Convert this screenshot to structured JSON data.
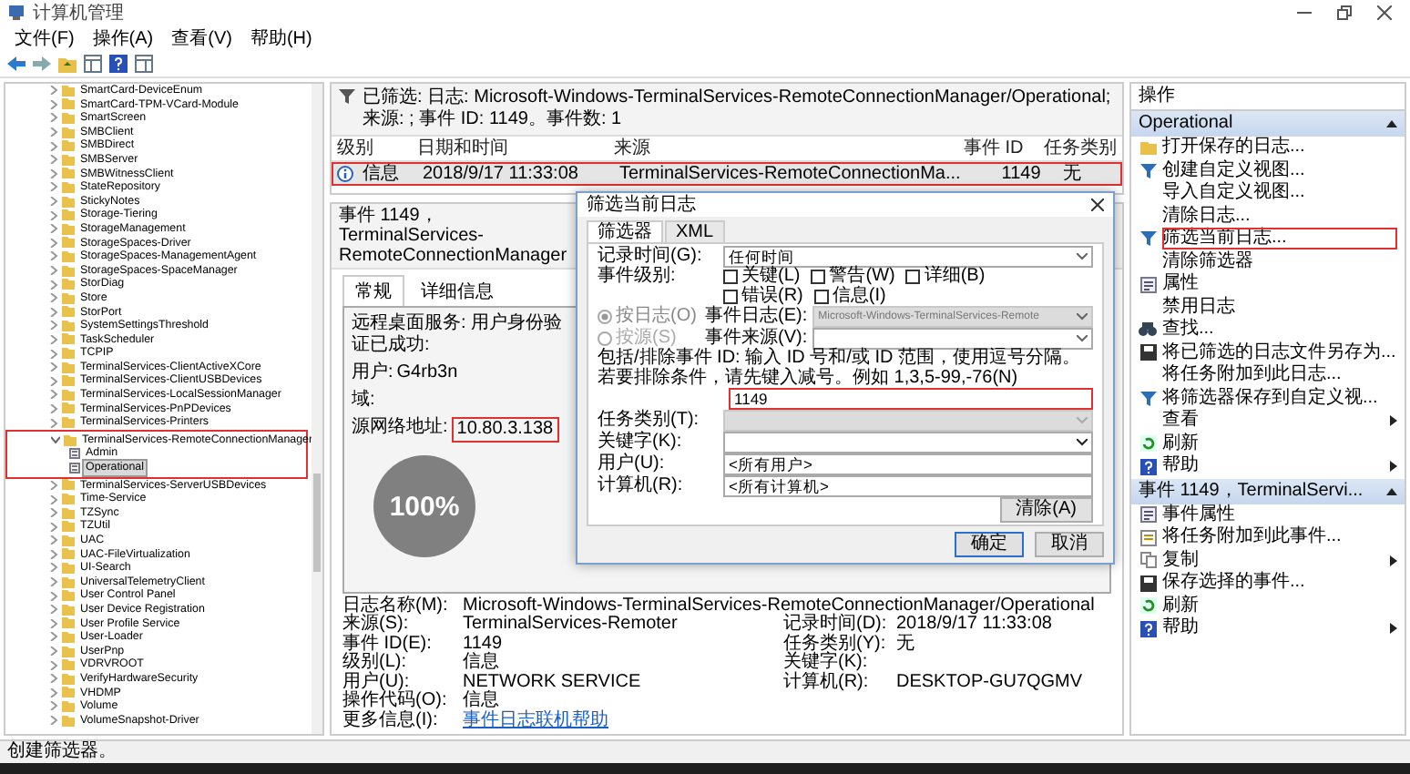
{
  "window": {
    "title": "计算机管理"
  },
  "menu": [
    "文件(F)",
    "操作(A)",
    "查看(V)",
    "帮助(H)"
  ],
  "tree": {
    "items": [
      {
        "label": "SmartCard-DeviceEnum",
        "kind": "folder",
        "expanded": false,
        "selected": false,
        "annotated": false
      },
      {
        "label": "SmartCard-TPM-VCard-Module",
        "kind": "folder",
        "expanded": false,
        "selected": false,
        "annotated": false
      },
      {
        "label": "SmartScreen",
        "kind": "folder",
        "expanded": false,
        "selected": false,
        "annotated": false
      },
      {
        "label": "SMBClient",
        "kind": "folder",
        "expanded": false,
        "selected": false,
        "annotated": false
      },
      {
        "label": "SMBDirect",
        "kind": "folder",
        "expanded": false,
        "selected": false,
        "annotated": false
      },
      {
        "label": "SMBServer",
        "kind": "folder",
        "expanded": false,
        "selected": false,
        "annotated": false
      },
      {
        "label": "SMBWitnessClient",
        "kind": "folder",
        "expanded": false,
        "selected": false,
        "annotated": false
      },
      {
        "label": "StateRepository",
        "kind": "folder",
        "expanded": false,
        "selected": false,
        "annotated": false
      },
      {
        "label": "StickyNotes",
        "kind": "folder",
        "expanded": false,
        "selected": false,
        "annotated": false
      },
      {
        "label": "Storage-Tiering",
        "kind": "folder",
        "expanded": false,
        "selected": false,
        "annotated": false
      },
      {
        "label": "StorageManagement",
        "kind": "folder",
        "expanded": false,
        "selected": false,
        "annotated": false
      },
      {
        "label": "StorageSpaces-Driver",
        "kind": "folder",
        "expanded": false,
        "selected": false,
        "annotated": false
      },
      {
        "label": "StorageSpaces-ManagementAgent",
        "kind": "folder",
        "expanded": false,
        "selected": false,
        "annotated": false
      },
      {
        "label": "StorageSpaces-SpaceManager",
        "kind": "folder",
        "expanded": false,
        "selected": false,
        "annotated": false
      },
      {
        "label": "StorDiag",
        "kind": "folder",
        "expanded": false,
        "selected": false,
        "annotated": false
      },
      {
        "label": "Store",
        "kind": "folder",
        "expanded": false,
        "selected": false,
        "annotated": false
      },
      {
        "label": "StorPort",
        "kind": "folder",
        "expanded": false,
        "selected": false,
        "annotated": false
      },
      {
        "label": "SystemSettingsThreshold",
        "kind": "folder",
        "expanded": false,
        "selected": false,
        "annotated": false
      },
      {
        "label": "TaskScheduler",
        "kind": "folder",
        "expanded": false,
        "selected": false,
        "annotated": false
      },
      {
        "label": "TCPIP",
        "kind": "folder",
        "expanded": false,
        "selected": false,
        "annotated": false
      },
      {
        "label": "TerminalServices-ClientActiveXCore",
        "kind": "folder",
        "expanded": false,
        "selected": false,
        "annotated": false
      },
      {
        "label": "TerminalServices-ClientUSBDevices",
        "kind": "folder",
        "expanded": false,
        "selected": false,
        "annotated": false
      },
      {
        "label": "TerminalServices-LocalSessionManager",
        "kind": "folder",
        "expanded": false,
        "selected": false,
        "annotated": false
      },
      {
        "label": "TerminalServices-PnPDevices",
        "kind": "folder",
        "expanded": false,
        "selected": false,
        "annotated": false
      },
      {
        "label": "TerminalServices-Printers",
        "kind": "folder",
        "expanded": false,
        "selected": false,
        "annotated": false
      },
      {
        "label": "TerminalServices-RemoteConnectionManager",
        "kind": "folder",
        "expanded": true,
        "selected": false,
        "annotated": true,
        "children": [
          {
            "label": "Admin",
            "kind": "log",
            "selected": false,
            "annotated": false
          },
          {
            "label": "Operational",
            "kind": "log",
            "selected": true,
            "annotated": false
          }
        ]
      },
      {
        "label": "TerminalServices-ServerUSBDevices",
        "kind": "folder",
        "expanded": false,
        "selected": false,
        "annotated": false
      },
      {
        "label": "Time-Service",
        "kind": "folder",
        "expanded": false,
        "selected": false,
        "annotated": false
      },
      {
        "label": "TZSync",
        "kind": "folder",
        "expanded": false,
        "selected": false,
        "annotated": false
      },
      {
        "label": "TZUtil",
        "kind": "folder",
        "expanded": false,
        "selected": false,
        "annotated": false
      },
      {
        "label": "UAC",
        "kind": "folder",
        "expanded": false,
        "selected": false,
        "annotated": false
      },
      {
        "label": "UAC-FileVirtualization",
        "kind": "folder",
        "expanded": false,
        "selected": false,
        "annotated": false
      },
      {
        "label": "UI-Search",
        "kind": "folder",
        "expanded": false,
        "selected": false,
        "annotated": false
      },
      {
        "label": "UniversalTelemetryClient",
        "kind": "folder",
        "expanded": false,
        "selected": false,
        "annotated": false
      },
      {
        "label": "User Control Panel",
        "kind": "folder",
        "expanded": false,
        "selected": false,
        "annotated": false
      },
      {
        "label": "User Device Registration",
        "kind": "folder",
        "expanded": false,
        "selected": false,
        "annotated": false
      },
      {
        "label": "User Profile Service",
        "kind": "folder",
        "expanded": false,
        "selected": false,
        "annotated": false
      },
      {
        "label": "User-Loader",
        "kind": "folder",
        "expanded": false,
        "selected": false,
        "annotated": false
      },
      {
        "label": "UserPnp",
        "kind": "folder",
        "expanded": false,
        "selected": false,
        "annotated": false
      },
      {
        "label": "VDRVROOT",
        "kind": "folder",
        "expanded": false,
        "selected": false,
        "annotated": false
      },
      {
        "label": "VerifyHardwareSecurity",
        "kind": "folder",
        "expanded": false,
        "selected": false,
        "annotated": false
      },
      {
        "label": "VHDMP",
        "kind": "folder",
        "expanded": false,
        "selected": false,
        "annotated": false
      },
      {
        "label": "Volume",
        "kind": "folder",
        "expanded": false,
        "selected": false,
        "annotated": false
      },
      {
        "label": "VolumeSnapshot-Driver",
        "kind": "folder",
        "expanded": false,
        "selected": false,
        "annotated": false
      }
    ]
  },
  "event_list": {
    "filter_text": "已筛选: 日志: Microsoft-Windows-TerminalServices-RemoteConnectionManager/Operational; 来源: ; 事件 ID: 1149。事件数: 1",
    "columns": [
      "级别",
      "日期和时间",
      "来源",
      "事件 ID",
      "任务类别"
    ],
    "rows": [
      {
        "cells": [
          "信息",
          "2018/9/17 11:33:08",
          "TerminalServices-RemoteConnectionMa...",
          "1149",
          "无"
        ],
        "selected": true,
        "annotated": true
      }
    ]
  },
  "event_detail": {
    "title": "事件 1149，TerminalServices-RemoteConnectionManager",
    "tabs": [
      {
        "label": "常规",
        "selected": true
      },
      {
        "label": "详细信息",
        "selected": false
      }
    ],
    "message": [
      {
        "label": "远程桌面服务: 用户身份验证已成功:",
        "annotated": false
      },
      {
        "label": "用户:",
        "value": "G4rb3n",
        "annotated": false
      },
      {
        "label": "域:",
        "annotated": false
      },
      {
        "label": "源网络地址:",
        "value": "10.80.3.138",
        "annotated": true
      }
    ],
    "fields": [
      [
        {
          "label": "日志名称(M):",
          "value": "Microsoft-Windows-TerminalServices-RemoteConnectionManager/Operational",
          "kind": "text"
        }
      ],
      [
        {
          "label": "来源(S):",
          "value": "TerminalServices-Remoter",
          "kind": "text"
        },
        {
          "label": "记录时间(D):",
          "value": "2018/9/17 11:33:08",
          "kind": "text"
        }
      ],
      [
        {
          "label": "事件 ID(E):",
          "value": "1149",
          "kind": "text"
        },
        {
          "label": "任务类别(Y):",
          "value": "无",
          "kind": "text"
        }
      ],
      [
        {
          "label": "级别(L):",
          "value": "信息",
          "kind": "text"
        },
        {
          "label": "关键字(K):",
          "kind": "text"
        }
      ],
      [
        {
          "label": "用户(U):",
          "value": "NETWORK SERVICE",
          "kind": "text"
        },
        {
          "label": "计算机(R):",
          "value": "DESKTOP-GU7QGMV",
          "kind": "text"
        }
      ],
      [
        {
          "label": "操作代码(O):",
          "value": "信息",
          "kind": "text"
        }
      ],
      [
        {
          "label": "更多信息(I):",
          "value": "事件日志联机帮助",
          "kind": "link"
        }
      ]
    ]
  },
  "zoom_indicator": "100%",
  "filter_dialog": {
    "title": "筛选当前日志",
    "tabs": [
      {
        "label": "筛选器",
        "selected": true
      },
      {
        "label": "XML",
        "selected": false
      }
    ],
    "logged": {
      "label": "记录时间(G):",
      "value": "任何时间"
    },
    "level_label": "事件级别:",
    "levels": [
      {
        "label": "关键(L)",
        "checked": false
      },
      {
        "label": "警告(W)",
        "checked": false
      },
      {
        "label": "详细(B)",
        "checked": false
      },
      {
        "label": "错误(R)",
        "checked": false
      },
      {
        "label": "信息(I)",
        "checked": false
      }
    ],
    "sources": [
      {
        "label": "按日志(O)",
        "selected": true,
        "field_label": "事件日志(E):",
        "value": "Microsoft-Windows-TerminalServices-Remote"
      },
      {
        "label": "按源(S)",
        "selected": false,
        "field_label": "事件来源(V):"
      }
    ],
    "id_hint": "包括/排除事件 ID: 输入 ID 号和/或 ID 范围，使用逗号分隔。若要排除条件，请先键入减号。例如 1,3,5-99,-76(N)",
    "id_value": "1149",
    "id_annotated": true,
    "fields": [
      {
        "label": "任务类别(T):",
        "kind": "combo",
        "enabled": false
      },
      {
        "label": "关键字(K):",
        "kind": "combo",
        "enabled": true
      },
      {
        "label": "用户(U):",
        "kind": "text",
        "value": "<所有用户>",
        "enabled": true
      },
      {
        "label": "计算机(R):",
        "kind": "text",
        "value": "<所有计算机>",
        "enabled": true
      }
    ],
    "clear_button": "清除(A)",
    "buttons": [
      {
        "label": "确定",
        "default": true
      },
      {
        "label": "取消",
        "default": false
      }
    ]
  },
  "actions": {
    "title": "操作",
    "sections": [
      {
        "title": "Operational",
        "items": [
          {
            "label": "打开保存的日志...",
            "kind": "open",
            "submenu": false,
            "annotated": false
          },
          {
            "label": "创建自定义视图...",
            "kind": "filter",
            "submenu": false,
            "annotated": false
          },
          {
            "label": "导入自定义视图...",
            "kind": "none",
            "submenu": false,
            "annotated": false
          },
          {
            "label": "清除日志...",
            "kind": "none",
            "submenu": false,
            "annotated": false
          },
          {
            "label": "筛选当前日志...",
            "kind": "filter",
            "submenu": false,
            "annotated": true
          },
          {
            "label": "清除筛选器",
            "kind": "none",
            "submenu": false,
            "annotated": false
          },
          {
            "label": "属性",
            "kind": "props",
            "submenu": false,
            "annotated": false
          },
          {
            "label": "禁用日志",
            "kind": "none",
            "submenu": false,
            "annotated": false
          },
          {
            "label": "查找...",
            "kind": "find",
            "submenu": false,
            "annotated": false
          },
          {
            "label": "将已筛选的日志文件另存为...",
            "kind": "save",
            "submenu": false,
            "annotated": false
          },
          {
            "label": "将任务附加到此日志...",
            "kind": "none",
            "submenu": false,
            "annotated": false
          },
          {
            "label": "将筛选器保存到自定义视...",
            "kind": "filter",
            "submenu": false,
            "annotated": false
          },
          {
            "label": "查看",
            "kind": "none",
            "submenu": true,
            "annotated": false
          },
          {
            "label": "刷新",
            "kind": "refresh",
            "submenu": false,
            "annotated": false
          },
          {
            "label": "帮助",
            "kind": "help",
            "submenu": true,
            "annotated": false
          }
        ]
      },
      {
        "title": "事件 1149，TerminalServi...",
        "items": [
          {
            "label": "事件属性",
            "kind": "props",
            "submenu": false,
            "annotated": false
          },
          {
            "label": "将任务附加到此事件...",
            "kind": "task",
            "submenu": false,
            "annotated": false
          },
          {
            "label": "复制",
            "kind": "copy",
            "submenu": true,
            "annotated": false
          },
          {
            "label": "保存选择的事件...",
            "kind": "save",
            "submenu": false,
            "annotated": false
          },
          {
            "label": "刷新",
            "kind": "refresh",
            "submenu": false,
            "annotated": false
          },
          {
            "label": "帮助",
            "kind": "help",
            "submenu": true,
            "annotated": false
          }
        ]
      }
    ]
  },
  "status_bar": "创建筛选器。"
}
